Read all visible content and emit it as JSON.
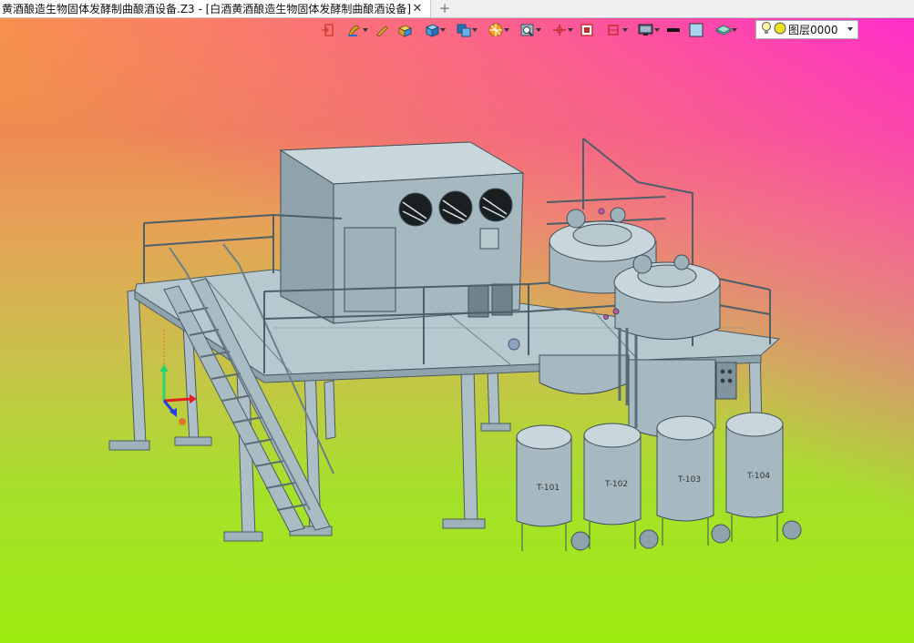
{
  "window": {
    "tab_title": "黄酒酿造生物固体发酵制曲酿酒设备.Z3 - [白酒黄酒酿造生物固体发酵制曲酿酒设备]",
    "close_glyph": "✕",
    "new_tab_glyph": "+"
  },
  "toolbar": {
    "layer_label": "图层0000",
    "icons": [
      "exit-icon",
      "paint-icon",
      "pen-icon",
      "box-icon",
      "cube-icon",
      "view-cube-icon",
      "render-icon",
      "zoom-view-icon",
      "axis-icon",
      "fit-icon",
      "section-icon",
      "display-icon",
      "line-style-icon",
      "color-icon",
      "layer-icon",
      "bulb-icon",
      "layer-color-dot"
    ]
  },
  "scene": {
    "tank_labels": [
      "T-101",
      "T-102",
      "T-103",
      "T-104"
    ],
    "colors": {
      "steel": "#aebfc7",
      "steel_dark": "#7f949e",
      "steel_light": "#c9d6dc",
      "bg_top_pink": "#ff2bd0",
      "bg_bottom_green": "#9cec10"
    }
  }
}
